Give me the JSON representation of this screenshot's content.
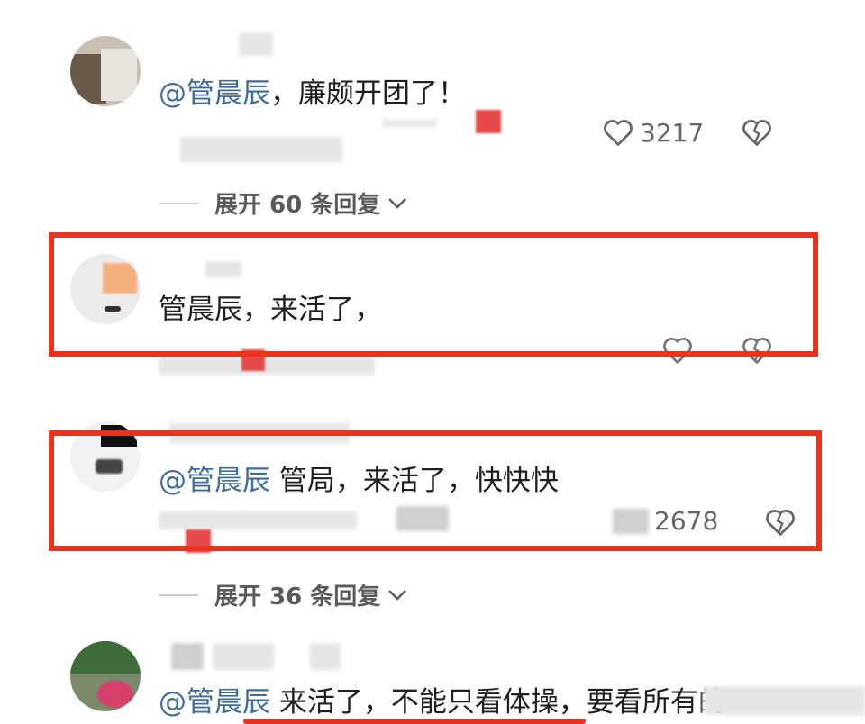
{
  "comments": [
    {
      "mention": "@管晨辰",
      "text": "，廉颇开团了！",
      "likes": "3217",
      "expand_label": "展开 60 条回复"
    },
    {
      "mention": "",
      "text": "管晨辰，来活了，",
      "likes": "",
      "highlighted": true
    },
    {
      "mention": "@管晨辰",
      "text": " 管局，来活了，快快快",
      "likes": "2678",
      "highlighted": true,
      "expand_label": "展开 36 条回复"
    },
    {
      "mention": "@管晨辰",
      "text": " 来活了，不能只看体操，要看所有的"
    }
  ],
  "colors": {
    "highlight": "#e8331f",
    "mention": "#3e6c9d"
  }
}
